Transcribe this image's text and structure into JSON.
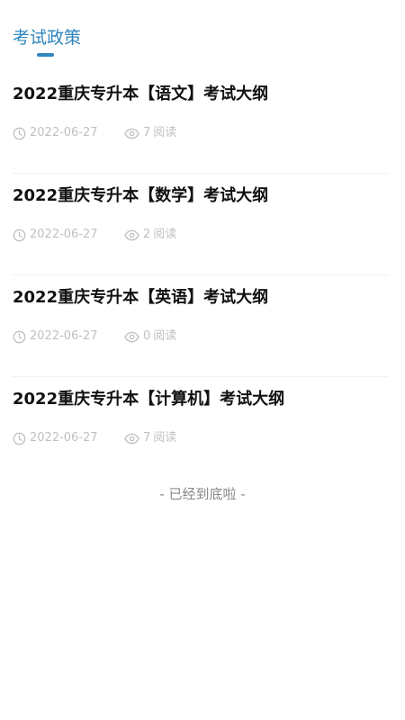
{
  "tabs": {
    "active_label": "考试政策"
  },
  "articles": [
    {
      "title": "2022重庆专升本【语文】考试大纲",
      "date": "2022-06-27",
      "views": "7",
      "views_suffix": "阅读"
    },
    {
      "title": "2022重庆专升本【数学】考试大纲",
      "date": "2022-06-27",
      "views": "2",
      "views_suffix": "阅读"
    },
    {
      "title": "2022重庆专升本【英语】考试大纲",
      "date": "2022-06-27",
      "views": "0",
      "views_suffix": "阅读"
    },
    {
      "title": "2022重庆专升本【计算机】考试大纲",
      "date": "2022-06-27",
      "views": "7",
      "views_suffix": "阅读"
    }
  ],
  "end_note": "- 已经到底啦 -",
  "icons": {
    "date": "clock-icon",
    "views": "eye-icon"
  },
  "colors": {
    "accent": "#2f86bd",
    "meta_text": "#c0c0c0",
    "end_note": "#888888"
  }
}
